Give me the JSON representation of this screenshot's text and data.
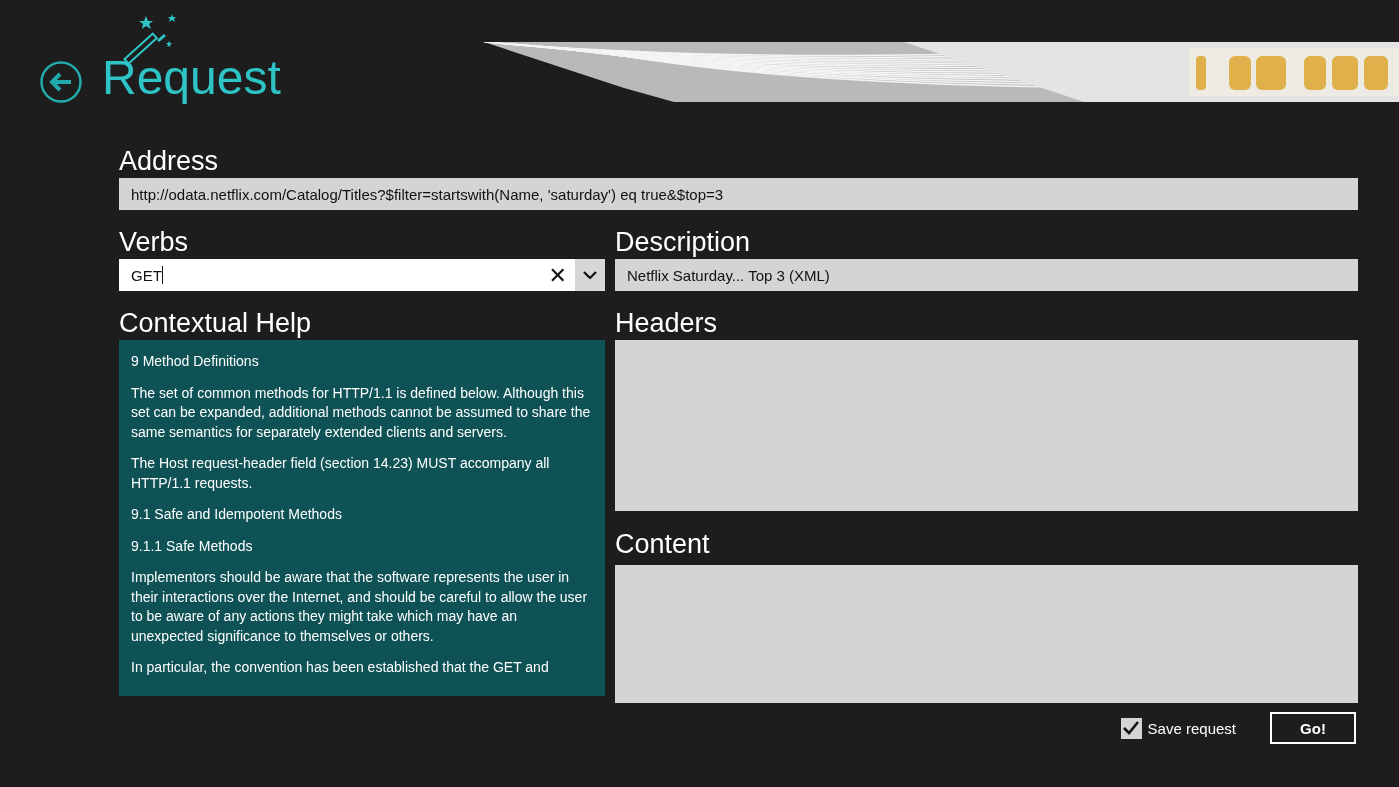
{
  "header": {
    "title": "Request"
  },
  "address": {
    "label": "Address",
    "value": "http://odata.netflix.com/Catalog/Titles?$filter=startswith(Name, 'saturday') eq true&$top=3"
  },
  "verbs": {
    "label": "Verbs",
    "value": "GET",
    "clear": "✕"
  },
  "description": {
    "label": "Description",
    "value": "Netflix Saturday... Top 3 (XML)"
  },
  "help": {
    "label": "Contextual Help",
    "paragraphs": [
      "9 Method Definitions",
      "The set of common methods for HTTP/1.1 is defined below. Although this set can be expanded, additional methods cannot be assumed to share the same semantics for separately extended clients and servers.",
      "The Host request-header field (section 14.23) MUST accompany all HTTP/1.1 requests.",
      "9.1 Safe and Idempotent Methods",
      "9.1.1 Safe Methods",
      "Implementors should be aware that the software represents the user in their interactions over the Internet, and should be careful to allow the user to be aware of any actions they might take which may have an unexpected significance to themselves or others.",
      "In particular, the convention has been established that the GET and"
    ]
  },
  "headers": {
    "label": "Headers"
  },
  "content": {
    "label": "Content"
  },
  "save_request": {
    "label": "Save request",
    "checked": true
  },
  "go_button": "Go!"
}
